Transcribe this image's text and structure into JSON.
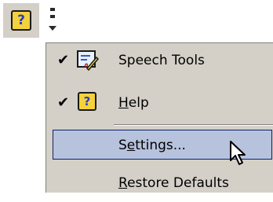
{
  "toolbar": {
    "help_glyph": "?"
  },
  "menu": {
    "items": [
      {
        "label": "Speech Tools",
        "mnemonic": "",
        "rest": "Speech Tools",
        "checked": true,
        "icon": "speech-tools-icon"
      },
      {
        "label": "Help",
        "mnemonic": "H",
        "rest": "elp",
        "checked": true,
        "icon": "help-icon"
      },
      {
        "label": "Settings...",
        "pre": "S",
        "mnemonic": "e",
        "rest": "ttings...",
        "checked": false,
        "icon": ""
      },
      {
        "label": "Restore Defaults",
        "mnemonic": "R",
        "rest": "estore Defaults",
        "checked": false,
        "icon": ""
      }
    ],
    "check_glyph": "✔",
    "highlight_color": "#b7c2dd"
  }
}
